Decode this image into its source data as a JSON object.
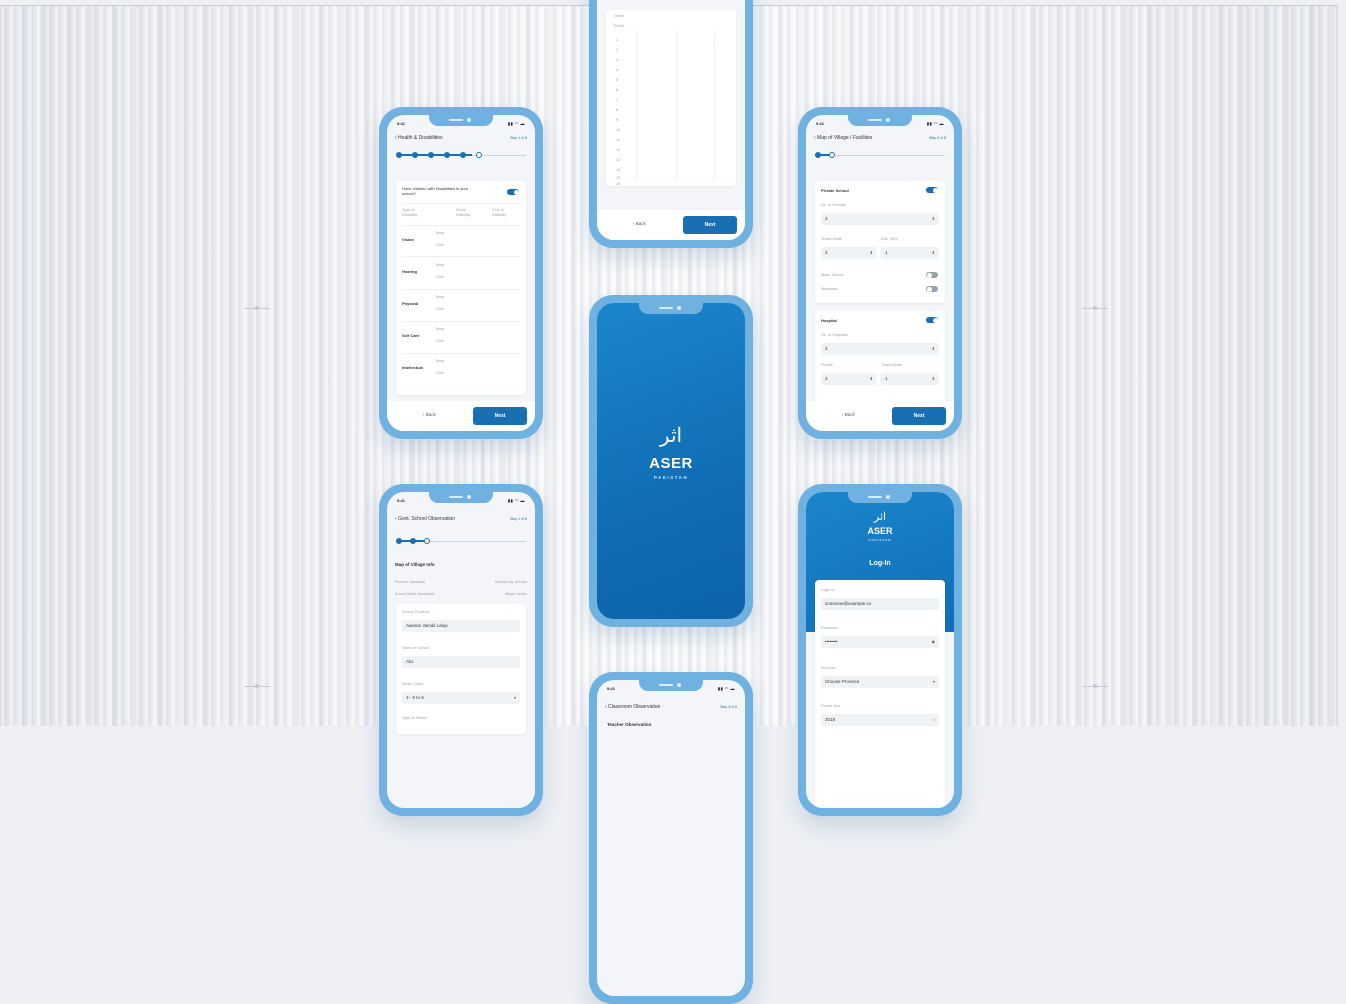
{
  "colors": {
    "primary": "#1a6fb3",
    "frame": "#6fb1e0",
    "splash": "#106db6"
  },
  "common": {
    "time": "9:41",
    "status_icons": "▮▮ ◠ ▬",
    "back": "‹ Back",
    "next": "Next"
  },
  "phone_top": {
    "labels": [
      "Name",
      "Public"
    ],
    "rows": [
      "1",
      "2",
      "3",
      "4",
      "5",
      "6",
      "7",
      "8",
      "9",
      "10",
      "11",
      "12",
      "13",
      "14",
      "15",
      "16"
    ]
  },
  "phone_health": {
    "title": "‹ Health & Disabilities",
    "step": "Step 1 of 8",
    "question": "Have children with Disabilities in your school?",
    "col_type": "Type of Disability",
    "col_some": "Some Difficulty",
    "col_lot": "A lot of Difficulty",
    "categories": [
      "Vision",
      "Hearing",
      "Physical",
      "Self Care",
      "Intellectual"
    ],
    "sub_boys": "Boys",
    "sub_girls": "Girls"
  },
  "phone_map": {
    "title": "‹ Map of Village / Facilities",
    "step": "Step 2 of 8",
    "private_school": "Private School",
    "no_schools": "No. of Schools",
    "no_schools_val": "3",
    "travel_mode": "Travel Mode",
    "dist_label": "Dist. (KM)",
    "travel_val": "3",
    "dist_val": "1",
    "madrasa_label": "Madr. School",
    "madrasa": "Madrassa",
    "hospital": "Hospital",
    "no_hospitals": "No. of Hospitals",
    "no_hospitals_val": "3",
    "private_label": "Private",
    "travel_mode_2": "Travel Mode",
    "private_val": "3",
    "travel_val_2": "1"
  },
  "phone_splash": {
    "urdu": "اثر",
    "brand": "ASER",
    "country": "PAKISTAN"
  },
  "phone_govt": {
    "title": "‹ Govt. School Observation",
    "step": "Step 1 of 8",
    "section": "Map of Village Info",
    "meta_province": "Province: Islamabad",
    "meta_surveyor": "Surveyed by: Ali Raza",
    "meta_district": "School District: Rawalpindi",
    "meta_village": "Village: Saddar",
    "survey_province_label": "Survey Province",
    "survey_province_val": "Awaran Jamali Lalup",
    "school_name_label": "Name of School",
    "school_name_val": "Abc",
    "which_class_label": "Which Class",
    "which_class_val": "3 - 5 to 6",
    "type_label": "Type of School"
  },
  "phone_login": {
    "urdu": "اثر",
    "brand": "ASER",
    "country": "PAKISTAN",
    "title": "Log-In",
    "login_id_label": "Login Id",
    "login_id_val": "someone@example.co",
    "password_label": "Password",
    "password_val": "••••••••",
    "province_label": "Province",
    "province_val": "Choose Province",
    "period_label": "Period Year",
    "period_val": "2018"
  },
  "phone_classroom": {
    "title": "‹ Classroom Observation",
    "step": "Step 3 of 8",
    "section": "Teacher Observation"
  }
}
